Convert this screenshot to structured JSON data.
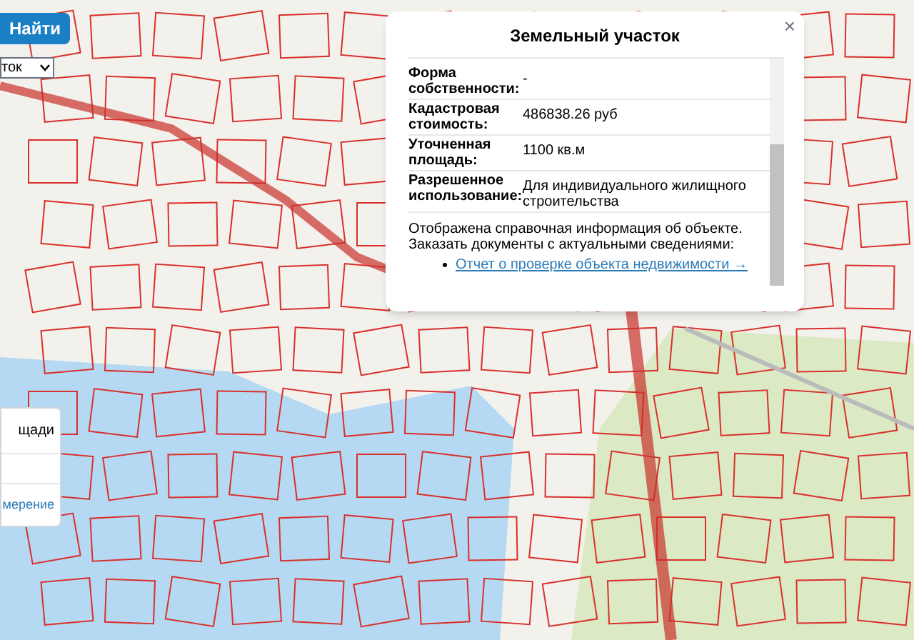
{
  "search_button": {
    "label": "Найти"
  },
  "region_select": {
    "value": "ток"
  },
  "side_panel": {
    "heading": "щади",
    "link": "мерение"
  },
  "popup": {
    "title": "Земельный участок",
    "close": "×",
    "rows": [
      {
        "label": "Форма собственности:",
        "value": "-"
      },
      {
        "label": "Кадастровая стоимость:",
        "value": "486838.26 руб"
      },
      {
        "label": "Уточненная площадь:",
        "value": "1100 кв.м"
      },
      {
        "label": "Разрешенное использование:",
        "value": "Для индивидуального жилищного строительства"
      }
    ],
    "note": "Отображена справочная информация об объекте. Заказать документы с актуальными сведениями:",
    "links": [
      "Отчет о проверке объекта недвижимости →"
    ]
  }
}
